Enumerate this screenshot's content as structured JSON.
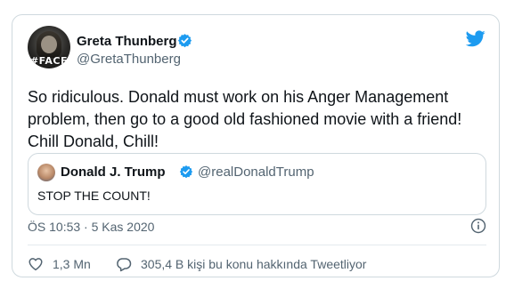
{
  "tweet": {
    "author": {
      "display_name": "Greta Thunberg",
      "handle": "@GretaThunberg",
      "verified": true,
      "avatar_text": "#FACE",
      "avatar_icon": "profile-photo"
    },
    "text": "So ridiculous. Donald must work on his Anger Management problem, then go to a good old fashioned movie with a friend! Chill Donald, Chill!",
    "quoted": {
      "display_name": "Donald J. Trump",
      "handle": "@realDonaldTrump",
      "verified": true,
      "text": "STOP THE COUNT!"
    },
    "timestamp": "ÖS 10:53 · 5 Kas 2020",
    "likes": "1,3 Mn",
    "replies_text": "305,4 B kişi bu konu hakkında Tweetliyor"
  },
  "colors": {
    "accent": "#1d9bf0",
    "text_primary": "#0f1419",
    "text_secondary": "#536471",
    "border": "#cfd9de"
  },
  "icons": {
    "brand": "twitter-bird-icon",
    "verified": "verified-badge-icon",
    "info": "info-icon",
    "like": "heart-icon",
    "reply": "speech-bubble-icon"
  }
}
